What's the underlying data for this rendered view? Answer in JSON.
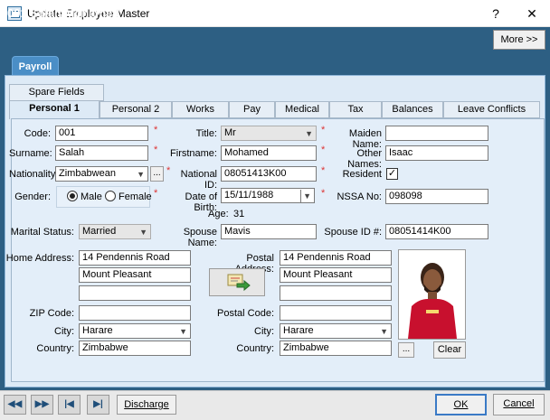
{
  "window": {
    "title": "Update Employee Master",
    "help": "?",
    "close": "✕"
  },
  "header": {
    "title": "001 Salah Mohamed",
    "more_label": "More >>"
  },
  "tabs_top": {
    "payroll": "Payroll"
  },
  "tabs_row2": {
    "spare": "Spare Fields"
  },
  "tabs_row1": [
    "Personal 1",
    "Personal 2",
    "Works",
    "Pay",
    "Medical",
    "Tax",
    "Balances",
    "Leave Conflicts"
  ],
  "labels": {
    "code": "Code:",
    "title": "Title:",
    "maiden": "Maiden Name:",
    "surname": "Surname:",
    "firstname": "Firstname:",
    "other_names": "Other Names:",
    "nationality": "Nationality",
    "national_id": "National ID:",
    "resident": "Resident",
    "gender": "Gender:",
    "dob": "Date of Birth:",
    "nssa": "NSSA No:",
    "age": "Age:",
    "marital": "Marital Status:",
    "spouse_name": "Spouse Name:",
    "spouse_id": "Spouse ID #:",
    "home_address": "Home Address:",
    "postal_address": "Postal Address:",
    "zip": "ZIP Code:",
    "postal_code": "Postal Code:",
    "city": "City:",
    "city2": "City:",
    "country": "Country:",
    "country2": "Country:"
  },
  "values": {
    "code": "001",
    "title": "Mr",
    "maiden": "",
    "surname": "Salah",
    "firstname": "Mohamed",
    "other_names": "Isaac",
    "nationality": "Zimbabwean",
    "national_id": "08051413K00",
    "resident": "✓",
    "gender_male": "Male",
    "gender_female": "Female",
    "dob": "15/11/1988",
    "nssa": "098098",
    "age": "31",
    "marital": "Married",
    "spouse_name": "Mavis",
    "spouse_id": "08051414K00",
    "home1": "14 Pendennis Road",
    "home2": "Mount Pleasant",
    "home3": "",
    "post1": "14 Pendennis Road",
    "post2": "Mount Pleasant",
    "post3": "",
    "zip": "",
    "postal_code": "",
    "city": "Harare",
    "city2": "Harare",
    "country": "Zimbabwe",
    "country2": "Zimbabwe"
  },
  "buttons": {
    "ellipsis": "...",
    "photo_browse": "...",
    "clear": "Clear",
    "discharge": "Discharge",
    "ok": "OK",
    "cancel": "Cancel"
  },
  "required_mark": "*",
  "colors": {
    "header": "#2d5f83",
    "panel": "#ddeaf6",
    "payroll_tab": "#4a8ec6"
  }
}
